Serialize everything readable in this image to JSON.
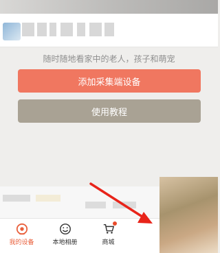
{
  "main": {
    "tagline": "随时随地看家中的老人，孩子和萌宠",
    "add_device_label": "添加采集端设备",
    "tutorial_label": "使用教程"
  },
  "tabbar": {
    "items": [
      {
        "label": "我的设备",
        "icon": "camera-icon",
        "active": true
      },
      {
        "label": "本地相册",
        "icon": "smile-icon",
        "active": false
      },
      {
        "label": "商城",
        "icon": "cart-icon",
        "active": false,
        "badge": true
      }
    ]
  },
  "colors": {
    "accent": "#f07760",
    "secondary": "#a9a294",
    "active_tab": "#e95f3b",
    "arrow": "#e8241a"
  }
}
